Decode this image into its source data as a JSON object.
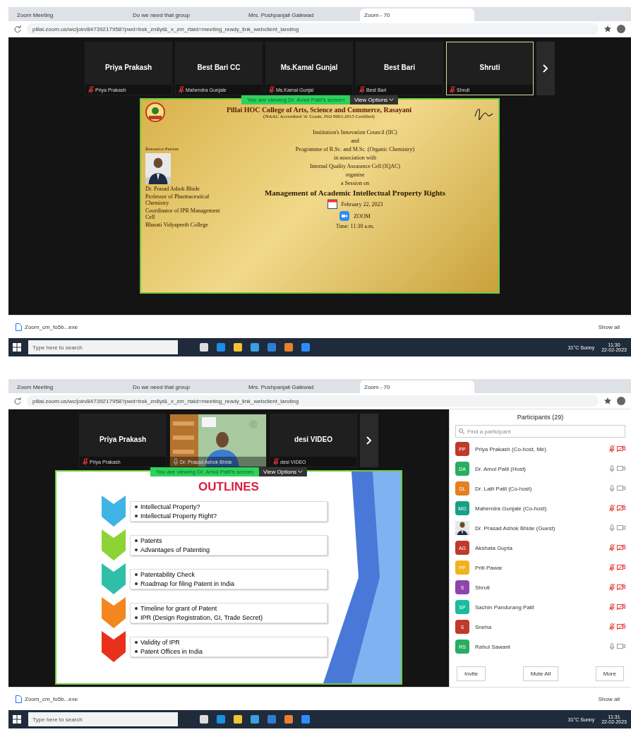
{
  "screenshots": [
    {
      "browser_tabs": [
        {
          "label": "Zoom Meeting",
          "selected": false
        },
        {
          "label": "Do we need that group",
          "selected": false
        },
        {
          "label": "Mrs. Pushpanjali Gaikwad",
          "selected": false
        },
        {
          "label": "Zoom - 70",
          "selected": true
        }
      ],
      "address": "pillai.zoom.us/wc/join/84739217958?pwd=bsk_zn8yt&_x_zm_rtaid=meeting_ready_link_webclient_landing",
      "meeting": {
        "video_strip": [
          {
            "name": "Priya Prakash",
            "caption": "Priya Prakash",
            "selected": false
          },
          {
            "name": "Best Bari CC",
            "caption": "Mahendra Gunjale",
            "selected": false
          },
          {
            "name": "Ms.Kamal Gunjal",
            "caption": "Ms.Kamal Gunjal",
            "selected": false
          },
          {
            "name": "Best Bari",
            "caption": "Best Bari",
            "selected": false
          },
          {
            "name": "Shruti",
            "caption": "Shruti",
            "selected": true
          }
        ],
        "share_banner": "You are viewing Dr. Amol Patil's screen",
        "view_options": "View Options",
        "slide": {
          "kind": "flyer",
          "college": "Pillai HOC College of Arts, Science and Commerce, Rasayani",
          "accreditation": "(NAAC Accredited 'A' Grade, ISO 9001:2015 Certified)",
          "lines": [
            "Institution's Innovation Council (IIC)",
            "and",
            "Programme of B.Sc. and M.Sc. (Organic Chemistry)",
            "in association with",
            "Internal Quality Assurance Cell (IQAC)",
            "organise",
            "a Session on"
          ],
          "title": "Management of Academic Intellectual Property Rights",
          "date": "February 22, 2023",
          "platform": "ZOOM",
          "time": "Time: 11:30 a.m.",
          "resource_label": "Resource Person",
          "speaker_lines": [
            "Dr. Prasad Ashok Bhide",
            "Professor of Pharmaceutical Chemistry",
            "Coordinator of IPR Management Cell",
            "Bharati Vidyapeeth College"
          ]
        }
      },
      "download_bar": {
        "file": "Zoom_cm_fo5b...exe",
        "show_all": "Show all"
      },
      "taskbar": {
        "search_placeholder": "Type here to search",
        "weather": "31°C Sunny",
        "time": "11:30",
        "date": "22-02-2023"
      }
    },
    {
      "browser_tabs": [
        {
          "label": "Zoom Meeting",
          "selected": false
        },
        {
          "label": "Do we need that group",
          "selected": false
        },
        {
          "label": "Mrs. Pushpanjali Gaikwad",
          "selected": false
        },
        {
          "label": "Zoom - 70",
          "selected": true
        }
      ],
      "address": "pillai.zoom.us/wc/join/84739217958?pwd=bsk_zn8yt&_x_zm_rtaid=meeting_ready_link_webclient_landing",
      "meeting": {
        "video_strip": [
          {
            "kind": "name",
            "name": "Priya Prakash",
            "caption": "Priya Prakash"
          },
          {
            "kind": "video",
            "caption": "Dr. Prasad Ashok Bhide"
          },
          {
            "kind": "name",
            "name": "desi VIDEO",
            "caption": "desi VIDEO"
          }
        ],
        "share_banner": "You are viewing Dr. Amol Patil's screen",
        "view_options": "View Options",
        "slide": {
          "kind": "outline",
          "title": "OUTLINES",
          "groups": [
            {
              "color": "#3fb4e6",
              "items": [
                "Intellectual Property?",
                "Intellectual Property Right?"
              ]
            },
            {
              "color": "#8dd335",
              "items": [
                "Patents",
                "Advantages of Patenting"
              ]
            },
            {
              "color": "#2fbfa8",
              "items": [
                "Patentability Check",
                "Roadmap for filing Patent in India"
              ]
            },
            {
              "color": "#f3861f",
              "items": [
                "Timeline for grant of Patent",
                "IPR (Design Registration, GI, Trade Secret)"
              ]
            },
            {
              "color": "#e8301c",
              "items": [
                "Validity of IPR",
                "Patent Offices in India"
              ]
            }
          ]
        }
      },
      "participants": {
        "title": "Participants (29)",
        "search_placeholder": "Find a participant",
        "people": [
          {
            "kind": "initials",
            "initials": "PP",
            "name": "Priya Prakash (Co-host, Me)",
            "color": "#c0392b",
            "muted": true
          },
          {
            "kind": "initials",
            "initials": "DA",
            "name": "Dr. Amol Patil (Host)",
            "color": "#27ae60",
            "muted": false
          },
          {
            "kind": "initials",
            "initials": "DL",
            "name": "Dr. Lalit Patil (Co-host)",
            "color": "#e67e22",
            "muted": false
          },
          {
            "kind": "initials",
            "initials": "MG",
            "name": "Mahendra Gunjale (Co-host)",
            "color": "#16a085",
            "muted": true
          },
          {
            "name": "Dr. Prasad Ashok Bhide (Guest)",
            "muted": false
          },
          {
            "kind": "initials",
            "initials": "AG",
            "name": "Akshata Gupta",
            "color": "#c0392b",
            "muted": true
          },
          {
            "kind": "initials",
            "initials": "PP",
            "name": "Priti Pawar",
            "color": "#f1b21d",
            "muted": true
          },
          {
            "kind": "initials",
            "initials": "S",
            "name": "Shruti",
            "color": "#8e44ad",
            "muted": true
          },
          {
            "kind": "initials",
            "initials": "SP",
            "name": "Sachin Pandurang Patil",
            "color": "#1abc9c",
            "muted": true
          },
          {
            "kind": "initials",
            "initials": "S",
            "name": "Sneha",
            "color": "#c0392b",
            "muted": true
          },
          {
            "kind": "initials",
            "initials": "RS",
            "name": "Rahul Sawant",
            "color": "#27ae60",
            "muted": false
          }
        ],
        "buttons": [
          "Invite",
          "Mute All",
          "More"
        ]
      },
      "download_bar": {
        "file": "Zoom_cm_fo5b...exe",
        "show_all": "Show all"
      },
      "taskbar": {
        "search_placeholder": "Type here to search",
        "weather": "31°C Sunny",
        "time": "11:31",
        "date": "22-02-2023"
      }
    }
  ]
}
